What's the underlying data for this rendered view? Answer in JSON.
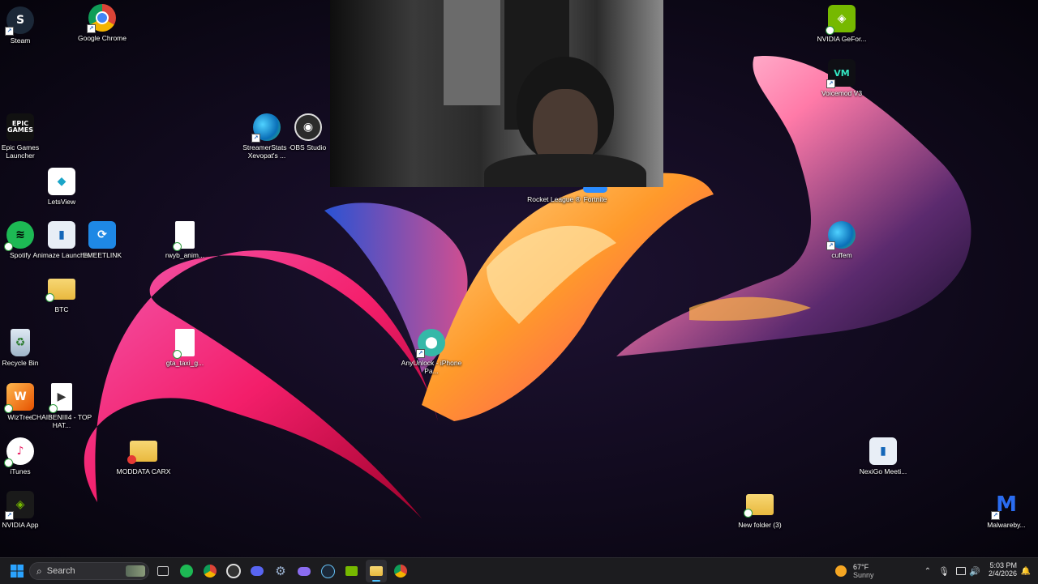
{
  "desktop": {
    "icons": [
      {
        "label": "Steam",
        "icon": "steam-icon"
      },
      {
        "label": "Google Chrome",
        "icon": "chrome-icon"
      },
      {
        "label": "Epic Games Launcher",
        "icon": "epic-games-icon",
        "glyph_text": "EPIC GAMES"
      },
      {
        "label": "StreamerStats - Xevopat's ...",
        "icon": "edge-icon"
      },
      {
        "label": "OBS Studio",
        "icon": "obs-icon"
      },
      {
        "label": "LetsView",
        "icon": "letsview-icon"
      },
      {
        "label": "Spotify",
        "icon": "spotify-icon"
      },
      {
        "label": "Animaze Launcher",
        "icon": "animaze-icon"
      },
      {
        "label": "EMEETLINK",
        "icon": "emeetlink-icon"
      },
      {
        "label": "rwyb_anim...",
        "icon": "file-icon"
      },
      {
        "label": "BTC",
        "icon": "folder-icon"
      },
      {
        "label": "Recycle Bin",
        "icon": "recycle-bin-icon"
      },
      {
        "label": "gta_taxi_g...",
        "icon": "file-icon"
      },
      {
        "label": "AnyUnlock - iPhone Pa...",
        "icon": "anyunlock-icon"
      },
      {
        "label": "WizTree",
        "icon": "wiztree-icon"
      },
      {
        "label": "CHAIBENIII4 - TOP HAT...",
        "icon": "video-file-icon"
      },
      {
        "label": "iTunes",
        "icon": "itunes-icon"
      },
      {
        "label": "MODDATA CARX",
        "icon": "folder-icon"
      },
      {
        "label": "NVIDIA App",
        "icon": "nvidia-icon"
      },
      {
        "label": "NVIDIA GeFor...",
        "icon": "nvidia-icon"
      },
      {
        "label": "Voicemod V3",
        "icon": "voicemod-icon"
      },
      {
        "label": "cuffem",
        "icon": "edge-icon"
      },
      {
        "label": "NexiGo Meeti...",
        "icon": "nexigo-icon"
      },
      {
        "label": "New folder (3)",
        "icon": "folder-icon"
      },
      {
        "label": "Malwareby...",
        "icon": "malwarebytes-icon"
      },
      {
        "label": "Rocket League ®",
        "icon": "rocket-league-icon"
      },
      {
        "label": "Fortnite",
        "icon": "fortnite-icon"
      }
    ]
  },
  "taskbar": {
    "search_label": "Search",
    "pinned": [
      {
        "icon": "task-view-icon"
      },
      {
        "icon": "spotify-icon"
      },
      {
        "icon": "chrome-icon"
      },
      {
        "icon": "obs-icon"
      },
      {
        "icon": "discord-icon"
      },
      {
        "icon": "settings-gear-icon"
      },
      {
        "icon": "gamepad-icon"
      },
      {
        "icon": "steam-icon"
      },
      {
        "icon": "nvidia-icon"
      },
      {
        "icon": "file-explorer-icon"
      },
      {
        "icon": "chrome-icon"
      }
    ],
    "weather": {
      "temp": "67°F",
      "condition": "Sunny"
    },
    "clock": {
      "time": "5:03 PM",
      "date": "2/4/2026"
    }
  },
  "colors": {
    "taskbar_bg": "#1c1c1f",
    "accent": "#0a84ff"
  }
}
